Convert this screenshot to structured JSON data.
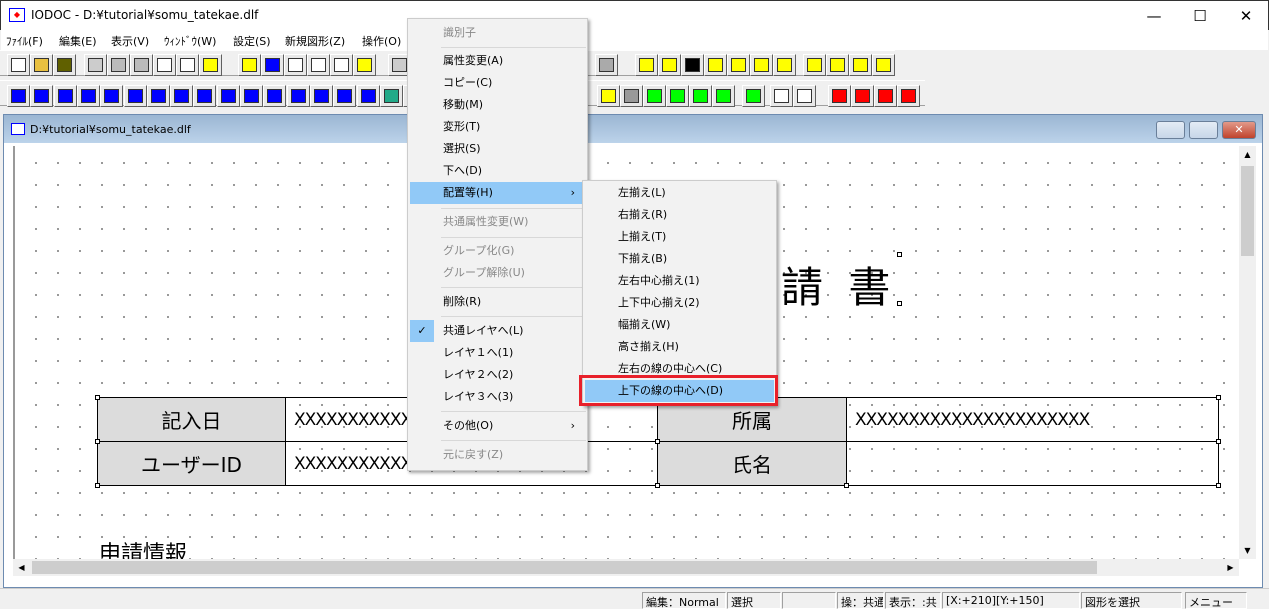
{
  "app": {
    "title": "IODOC - D:¥tutorial¥somu_tatekae.dlf",
    "minimize": "—",
    "maximize": "☐",
    "close": "✕"
  },
  "menubar": [
    "ﾌｧｲﾙ(F)",
    "編集(E)",
    "表示(V)",
    "ｳｨﾝﾄﾞｳ(W)",
    "設定(S)",
    "新規図形(Z)",
    "操作(O)"
  ],
  "child": {
    "title": "D:¥tutorial¥somu_tatekae.dlf"
  },
  "document": {
    "title_visible": "請 書",
    "rows": [
      [
        "記入日",
        "XXXXXXXXXXXXXXXXXXXXXX",
        "所属",
        "XXXXXXXXXXXXXXXXXXXXXX"
      ],
      [
        "ユーザーID",
        "XXXXXXXXXXXXXXXXXXXXXX",
        "氏名",
        ""
      ]
    ],
    "section": "申請情報"
  },
  "context_menu": {
    "items": [
      {
        "label": "識別子",
        "disabled": true
      },
      {
        "label": "属性変更(A)"
      },
      {
        "label": "コピー(C)"
      },
      {
        "label": "移動(M)"
      },
      {
        "label": "変形(T)"
      },
      {
        "label": "選択(S)"
      },
      {
        "label": "下へ(D)"
      },
      {
        "label": "配置等(H)",
        "submenu": true,
        "highlighted": true
      },
      {
        "label": "共通属性変更(W)",
        "disabled": true
      },
      {
        "label": "グループ化(G)",
        "disabled": true
      },
      {
        "label": "グループ解除(U)",
        "disabled": true
      },
      {
        "label": "削除(R)"
      },
      {
        "label": "共通レイヤへ(L)",
        "checked": true
      },
      {
        "label": "レイヤ１へ(1)"
      },
      {
        "label": "レイヤ２へ(2)"
      },
      {
        "label": "レイヤ３へ(3)"
      },
      {
        "label": "その他(O)",
        "submenu": true
      },
      {
        "label": "元に戻す(Z)",
        "disabled": true
      }
    ],
    "submenu_arrow": "›",
    "check": "✓"
  },
  "submenu": {
    "items": [
      "左揃え(L)",
      "右揃え(R)",
      "上揃え(T)",
      "下揃え(B)",
      "左右中心揃え(1)",
      "上下中心揃え(2)",
      "幅揃え(W)",
      "高さ揃え(H)",
      "左右の線の中心へ(C)",
      "上下の線の中心へ(D)"
    ],
    "highlighted_index": 9
  },
  "statusbar": [
    "編集：Normal",
    "選択",
    "",
    "操：共通",
    "表示：:共",
    "[X:+210][Y:+150]",
    "図形を選択",
    "メニュー"
  ],
  "colors": {
    "highlight": "#91c9f7",
    "annotation": "#e8202a",
    "tool_blue": "#0000ff",
    "tool_yellow": "#ffff00",
    "tool_green": "#00ff00"
  }
}
